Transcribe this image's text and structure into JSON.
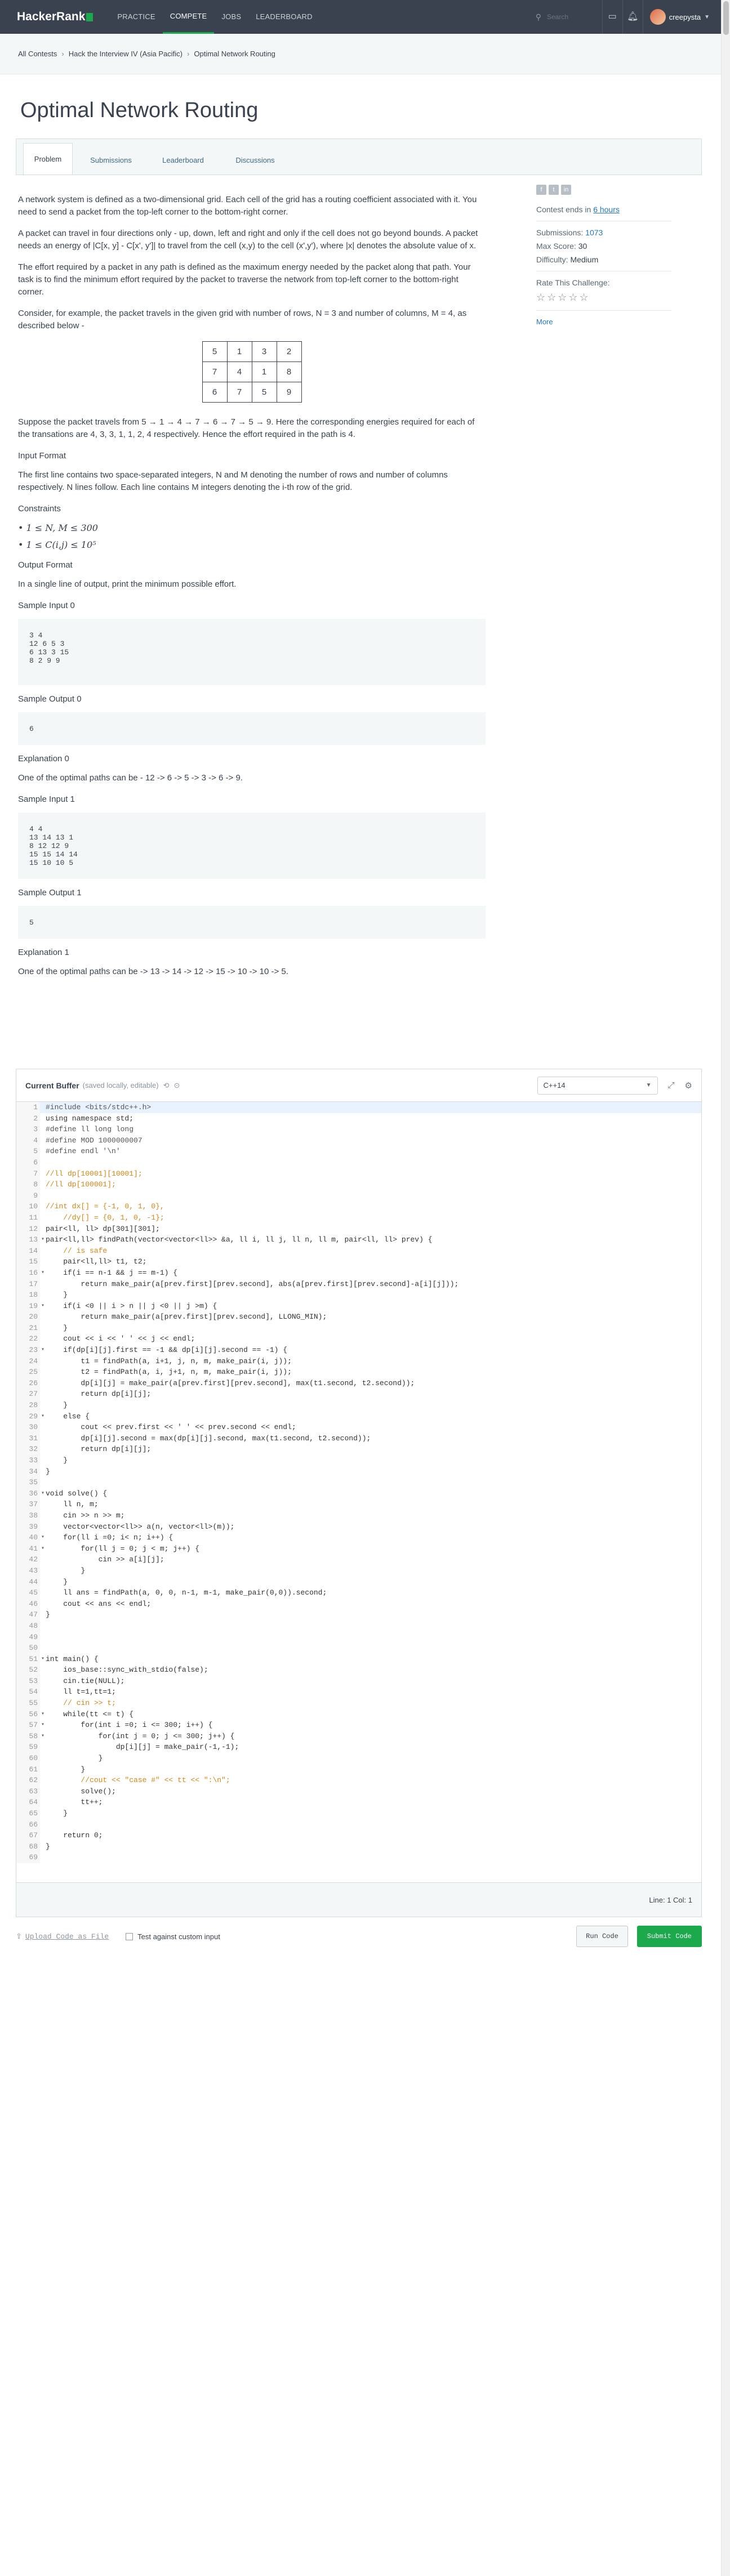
{
  "nav": {
    "logo_text": "HackerRank",
    "links": [
      "PRACTICE",
      "COMPETE",
      "JOBS",
      "LEADERBOARD"
    ],
    "active_index": 1,
    "search_placeholder": "Search",
    "username": "creepysta",
    "colors": {
      "bar": "#39424e",
      "brand_green": "#1ba94c"
    }
  },
  "breadcrumb": [
    "All Contests",
    "Hack the Interview IV (Asia Pacific)",
    "Optimal Network Routing"
  ],
  "title": "Optimal Network Routing",
  "tabs": [
    "Problem",
    "Submissions",
    "Leaderboard",
    "Discussions"
  ],
  "problem": {
    "p1": "A network system is defined as a two-dimensional grid. Each cell of the grid has a routing coefficient associated with it. You need to send a packet from the top-left corner to the bottom-right corner.",
    "p2": "A packet can travel in four directions only - up, down, left and right and only if the cell does not go beyond bounds. A packet needs an energy of |C[x, y] - C[x', y']| to travel from the cell (x,y) to the cell (x',y'), where |x| denotes the absolute value of x.",
    "p3": "The effort required by a packet in any path is defined as the maximum energy needed by the packet along that path. Your task is to find the minimum effort required by the packet to traverse the network from top-left corner to the bottom-right corner.",
    "p4": "Consider, for example, the packet travels in the given grid with number of rows, N = 3 and number of columns, M = 4, as described below -",
    "grid": [
      [
        "5",
        "1",
        "3",
        "2"
      ],
      [
        "7",
        "4",
        "1",
        "8"
      ],
      [
        "6",
        "7",
        "5",
        "9"
      ]
    ],
    "p5": "Suppose the packet travels from 5 → 1 → 4 → 7 → 6 → 7 → 5 → 9. Here the corresponding energies required for each of the transations are 4, 3, 3, 1, 1, 2, 4 respectively. Hence the effort required in the path is 4.",
    "input_format_heading": "Input Format",
    "input_format": "The first line contains two space-separated integers, N and M denoting the number of rows and number of columns respectively. N lines follow. Each line contains M integers denoting the i-th row of the grid.",
    "constraints_heading": "Constraints",
    "constraints": [
      "1 ≤ N, M ≤ 300",
      "1 ≤ C(i,j) ≤ 10⁵"
    ],
    "output_format_heading": "Output Format",
    "output_format": "In a single line of output, print the minimum possible effort.",
    "sample_input_0_heading": "Sample Input 0",
    "sample_input_0": "3 4\n12 6 5 3\n6 13 3 15\n8 2 9 9",
    "sample_output_0_heading": "Sample Output 0",
    "sample_output_0": "6",
    "explanation_0_heading": "Explanation 0",
    "explanation_0": "One of the optimal paths can be - 12 -> 6 -> 5 -> 3 -> 6 -> 9.",
    "sample_input_1_heading": "Sample Input 1",
    "sample_input_1": "4 4\n13 14 13 1\n8 12 12 9\n15 15 14 14\n15 10 10 5",
    "sample_output_1_heading": "Sample Output 1",
    "sample_output_1": "5",
    "explanation_1_heading": "Explanation 1",
    "explanation_1": "One of the optimal paths can be -> 13 -> 14 -> 12 -> 15 -> 10 -> 10 -> 5."
  },
  "sidebar": {
    "contest_ends_prefix": "Contest ends in",
    "contest_ends_value": "6 hours",
    "submissions_label": "Submissions:",
    "submissions_value": "1073",
    "max_score_label": "Max Score:",
    "max_score_value": "30",
    "difficulty_label": "Difficulty:",
    "difficulty_value": "Medium",
    "rate_label": "Rate This Challenge:",
    "stars": "☆☆☆☆☆",
    "more": "More"
  },
  "editor": {
    "title": "Current Buffer",
    "saved_note": "(saved locally, editable)",
    "language": "C++14",
    "cursor_info": "Line: 1 Col: 1",
    "code": [
      "#include <bits/stdc++.h>",
      "using namespace std;",
      "#define ll long long",
      "#define MOD 1000000007",
      "#define endl '\\n'",
      "",
      "//ll dp[10001][10001];",
      "//ll dp[100001];",
      "",
      "//int dx[] = {-1, 0, 1, 0},",
      "    //dy[] = {0, 1, 0, -1};",
      "pair<ll, ll> dp[301][301];",
      "pair<ll,ll> findPath(vector<vector<ll>> &a, ll i, ll j, ll n, ll m, pair<ll, ll> prev) {",
      "    // is safe",
      "    pair<ll,ll> t1, t2;",
      "    if(i == n-1 && j == m-1) {",
      "        return make_pair(a[prev.first][prev.second], abs(a[prev.first][prev.second]-a[i][j]));",
      "    }",
      "    if(i <0 || i > n || j <0 || j >m) {",
      "        return make_pair(a[prev.first][prev.second], LLONG_MIN);",
      "    }",
      "    cout << i << ' ' << j << endl;",
      "    if(dp[i][j].first == -1 && dp[i][j].second == -1) {",
      "        t1 = findPath(a, i+1, j, n, m, make_pair(i, j));",
      "        t2 = findPath(a, i, j+1, n, m, make_pair(i, j));",
      "        dp[i][j] = make_pair(a[prev.first][prev.second], max(t1.second, t2.second));",
      "        return dp[i][j];",
      "    }",
      "    else {",
      "        cout << prev.first << ' ' << prev.second << endl;",
      "        dp[i][j].second = max(dp[i][j].second, max(t1.second, t2.second));",
      "        return dp[i][j];",
      "    }",
      "}",
      "",
      "void solve() {",
      "    ll n, m;",
      "    cin >> n >> m;",
      "    vector<vector<ll>> a(n, vector<ll>(m));",
      "    for(ll i =0; i< n; i++) {",
      "        for(ll j = 0; j < m; j++) {",
      "            cin >> a[i][j];",
      "        }",
      "    }",
      "    ll ans = findPath(a, 0, 0, n-1, m-1, make_pair(0,0)).second;",
      "    cout << ans << endl;",
      "}",
      "",
      "",
      "",
      "int main() {",
      "    ios_base::sync_with_stdio(false);",
      "    cin.tie(NULL);",
      "    ll t=1,tt=1;",
      "    // cin >> t;",
      "    while(tt <= t) {",
      "        for(int i =0; i <= 300; i++) {",
      "            for(int j = 0; j <= 300; j++) {",
      "                dp[i][j] = make_pair(-1,-1);",
      "            }",
      "        }",
      "        //cout << \"case #\" << tt << \":\\n\";",
      "        solve();",
      "        tt++;",
      "    }",
      "",
      "    return 0;",
      "}",
      ""
    ]
  },
  "actions": {
    "upload": "Upload Code as File",
    "custom_input": "Test against custom input",
    "run": "Run Code",
    "submit": "Submit Code"
  }
}
